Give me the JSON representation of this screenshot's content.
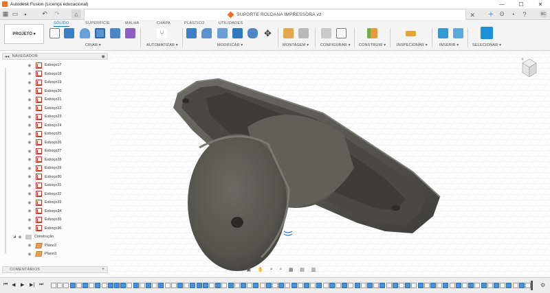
{
  "app": {
    "title": "Autodesk Fusion (Licença educacional)",
    "window_controls": [
      "—",
      "☐",
      "✕"
    ]
  },
  "tabbar": {
    "document_title": "SUPORTE ROLDANA IMPRESSORA v2",
    "user_initials": "BC"
  },
  "ribbon": {
    "project_label": "PROJETO ▾",
    "workspace_tabs": [
      "SÓLIDO",
      "SUPERFÍCIE",
      "MALHA",
      "CHAPA",
      "PLÁSTICO",
      "UTILIDADES"
    ],
    "active_tab": "SÓLIDO",
    "groups": [
      "CRIAR ▾",
      "AUTOMATIZAR ▾",
      "MODIFICAR ▾",
      "MONTAGEM ▾",
      "CONFIGURAR ▾",
      "CONSTRUIR ▾",
      "INSPECIONAR ▾",
      "INSERIR ▾",
      "SELECIONAR ▾"
    ]
  },
  "browser": {
    "header": "NAVEGADOR",
    "items": [
      {
        "label": "Esboço17",
        "kind": "sketch"
      },
      {
        "label": "Esboço18",
        "kind": "sketch"
      },
      {
        "label": "Esboço19",
        "kind": "sketch"
      },
      {
        "label": "Esboço20",
        "kind": "sketch"
      },
      {
        "label": "Esboço21",
        "kind": "sketch"
      },
      {
        "label": "Esboço22",
        "kind": "sketch"
      },
      {
        "label": "Esboço23",
        "kind": "sketch"
      },
      {
        "label": "Esboço24",
        "kind": "sketch"
      },
      {
        "label": "Esboço25",
        "kind": "sketch"
      },
      {
        "label": "Esboço26",
        "kind": "sketch"
      },
      {
        "label": "Esboço27",
        "kind": "sketch"
      },
      {
        "label": "Esboço28",
        "kind": "sketch"
      },
      {
        "label": "Esboço29",
        "kind": "sketch"
      },
      {
        "label": "Esboço30",
        "kind": "sketch"
      },
      {
        "label": "Esboço31",
        "kind": "sketch"
      },
      {
        "label": "Esboço32",
        "kind": "sketch"
      },
      {
        "label": "Esboço33",
        "kind": "sketch"
      },
      {
        "label": "Esboço34",
        "kind": "sketch"
      },
      {
        "label": "Esboço35",
        "kind": "sketch"
      },
      {
        "label": "Esboço36",
        "kind": "sketch"
      },
      {
        "label": "Construção",
        "kind": "folder"
      },
      {
        "label": "Plano2",
        "kind": "plane"
      },
      {
        "label": "Plano3",
        "kind": "plane"
      }
    ]
  },
  "comments": {
    "label": "COMENTÁRIOS",
    "add": "+"
  },
  "colors": {
    "accent": "#0a6fd1",
    "model": "#5c5a55",
    "sketch_icon": "#c0392b",
    "timeline_feature": "#4a90d9"
  },
  "icons": {
    "viewbar": [
      "orbit-icon",
      "camera-icon",
      "pan-icon",
      "zoom-icon",
      "zoom-window-icon",
      "display-settings-icon",
      "grid-icon",
      "viewports-icon"
    ],
    "timeline_controls": [
      "first-icon",
      "prev-icon",
      "play-icon",
      "next-icon",
      "last-icon"
    ]
  }
}
